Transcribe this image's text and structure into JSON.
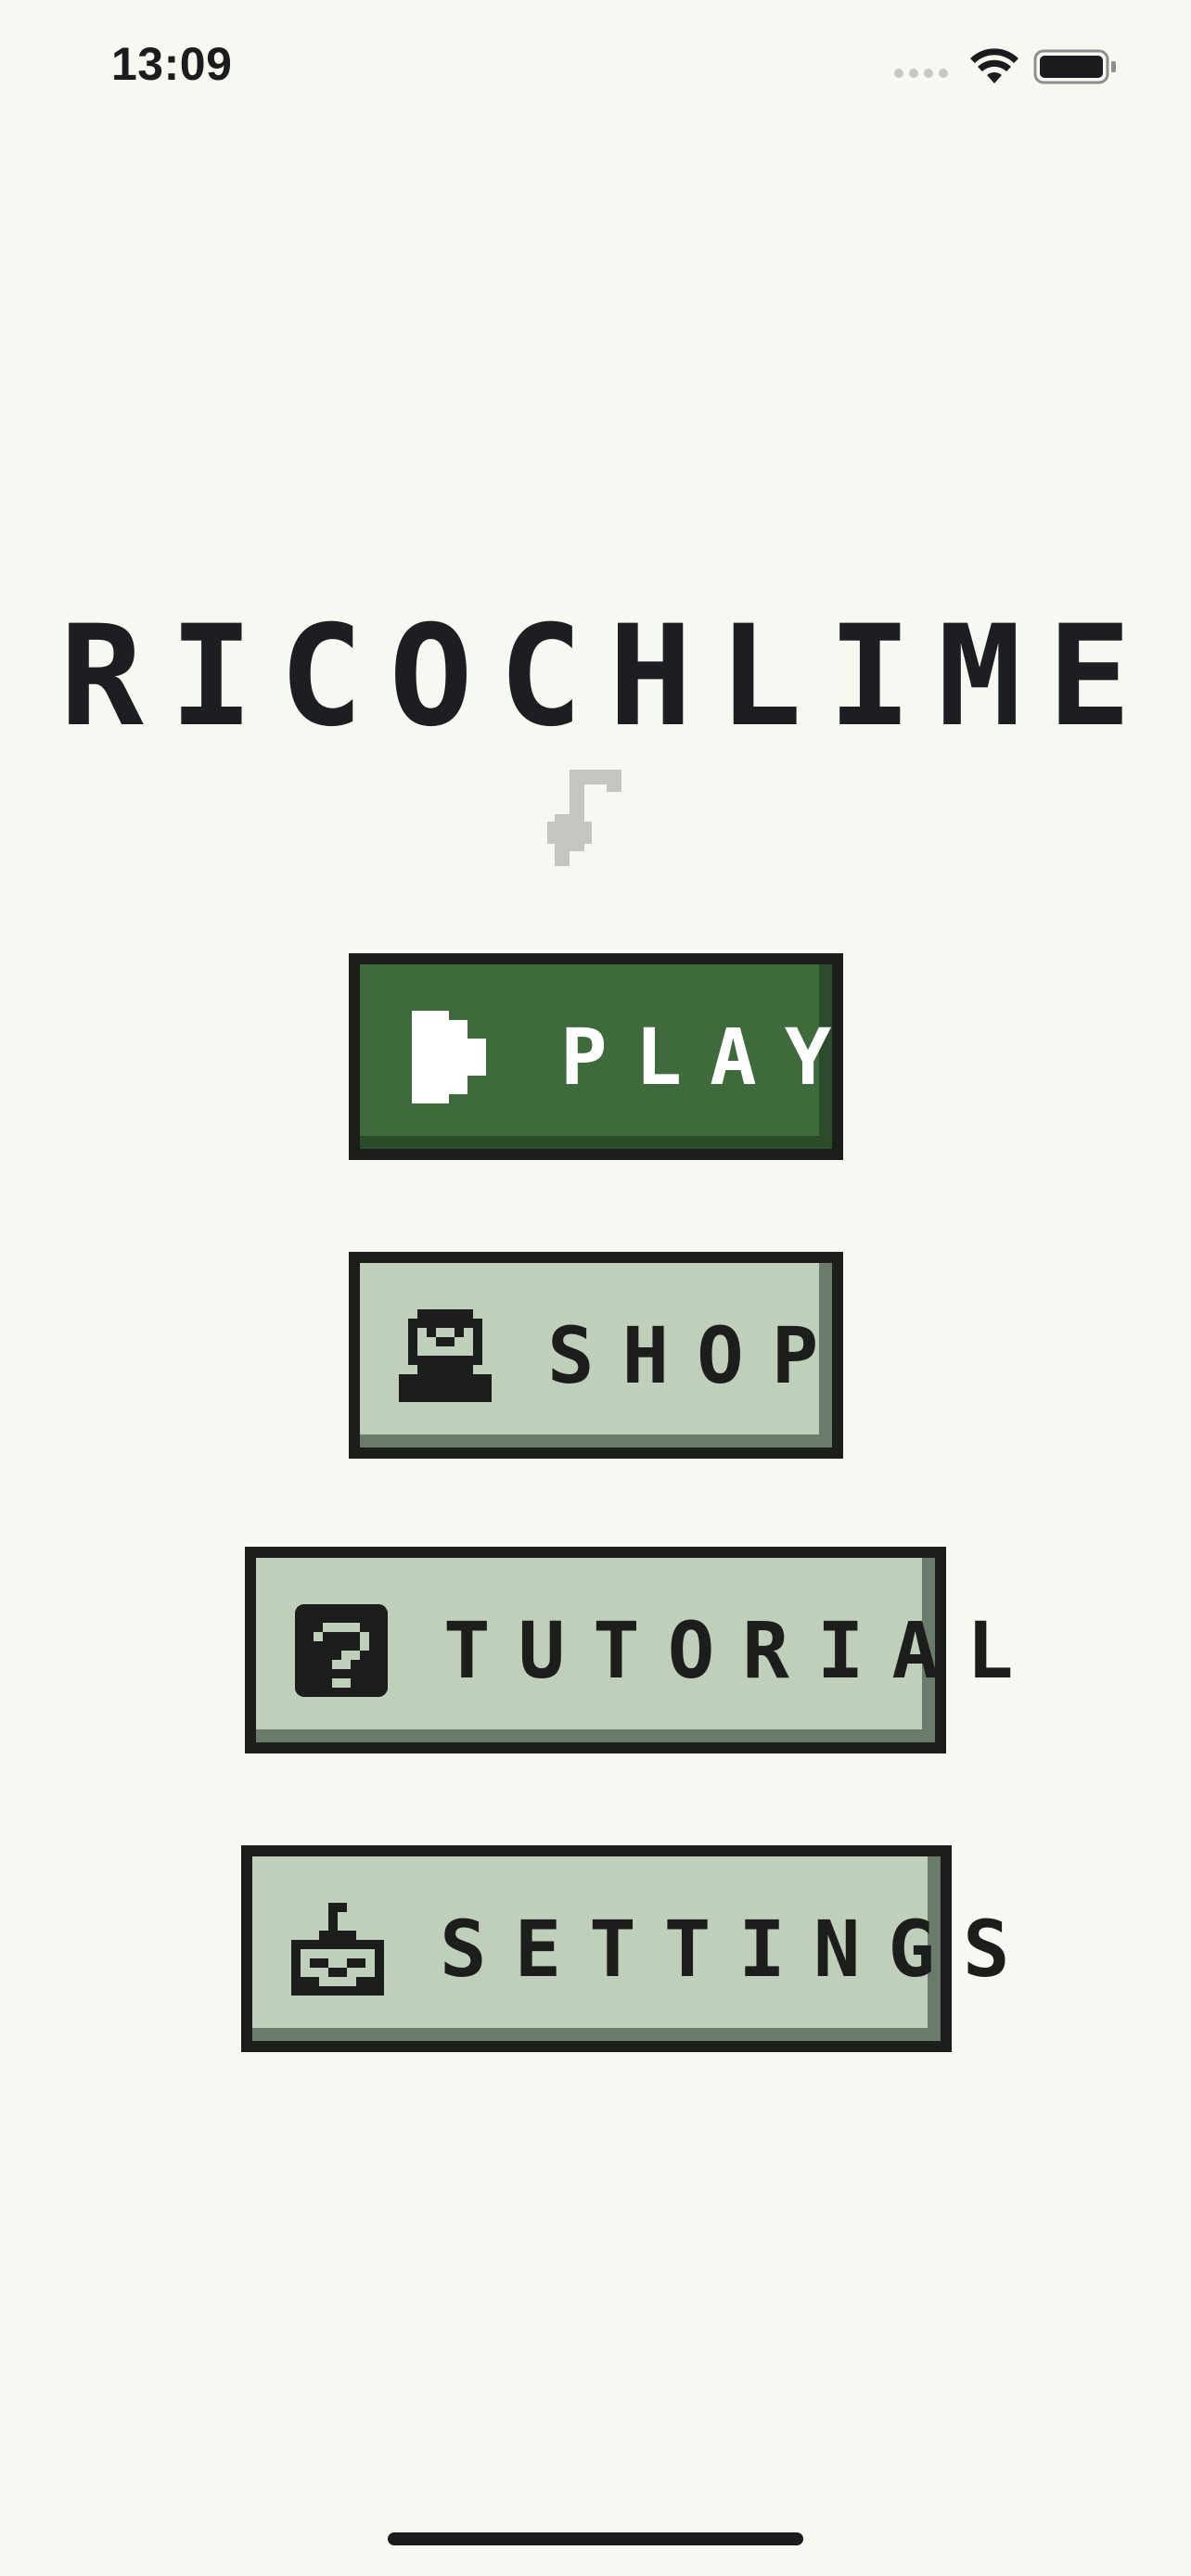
{
  "status_bar": {
    "time": "13:09",
    "icons": [
      "signal-icon",
      "wifi-icon",
      "battery-icon"
    ]
  },
  "title": "RICOCHLIME",
  "music_icon": "music-note-icon",
  "menu": {
    "play": {
      "label": "PLAY",
      "icon": "play-icon"
    },
    "shop": {
      "label": "SHOP",
      "icon": "shop-icon"
    },
    "tutorial": {
      "label": "TUTORIAL",
      "icon": "question-icon"
    },
    "settings": {
      "label": "SETTINGS",
      "icon": "settings-icon"
    }
  },
  "colors": {
    "background": "#f6f9f1",
    "play_button": "#3f6b3c",
    "secondary_button": "#bfcfba",
    "border": "#1c1e1b",
    "title_text": "#1e1e22",
    "music_note": "#c4c6c0"
  }
}
